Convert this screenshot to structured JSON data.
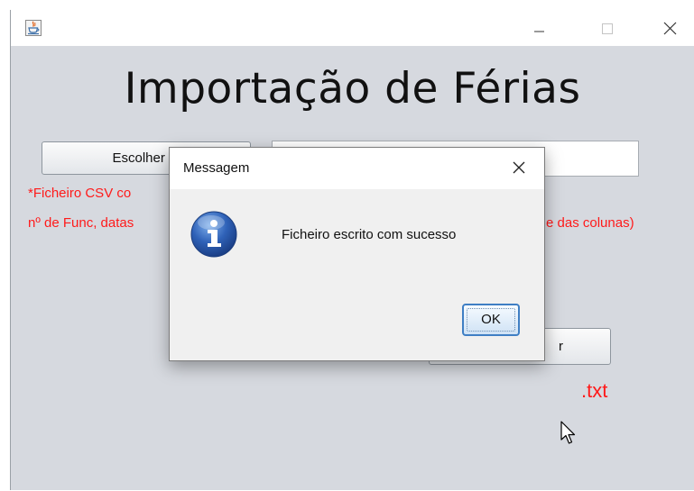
{
  "window": {
    "title": "",
    "controls": {
      "minimize": "minimize-icon",
      "maximize": "maximize-icon",
      "close": "close-icon"
    }
  },
  "main": {
    "heading": "Importação de Férias",
    "choose_button_label": "Escolher Fi",
    "file_path_value": "",
    "note_line1": "*Ficheiro CSV co",
    "note_line2_left": "nº de Func, datas",
    "note_line2_right": "e das colunas)",
    "write_button_label": "r",
    "extension_label": ".txt"
  },
  "dialog": {
    "title": "Messagem",
    "message": "Ficheiro escrito com sucesso",
    "ok_label": "OK",
    "icon": "info-icon"
  },
  "colors": {
    "window_bg": "#d6d9df",
    "note_red": "#ff1a1a",
    "info_blue": "#2f62b8",
    "ok_border": "#3f7fc4"
  }
}
